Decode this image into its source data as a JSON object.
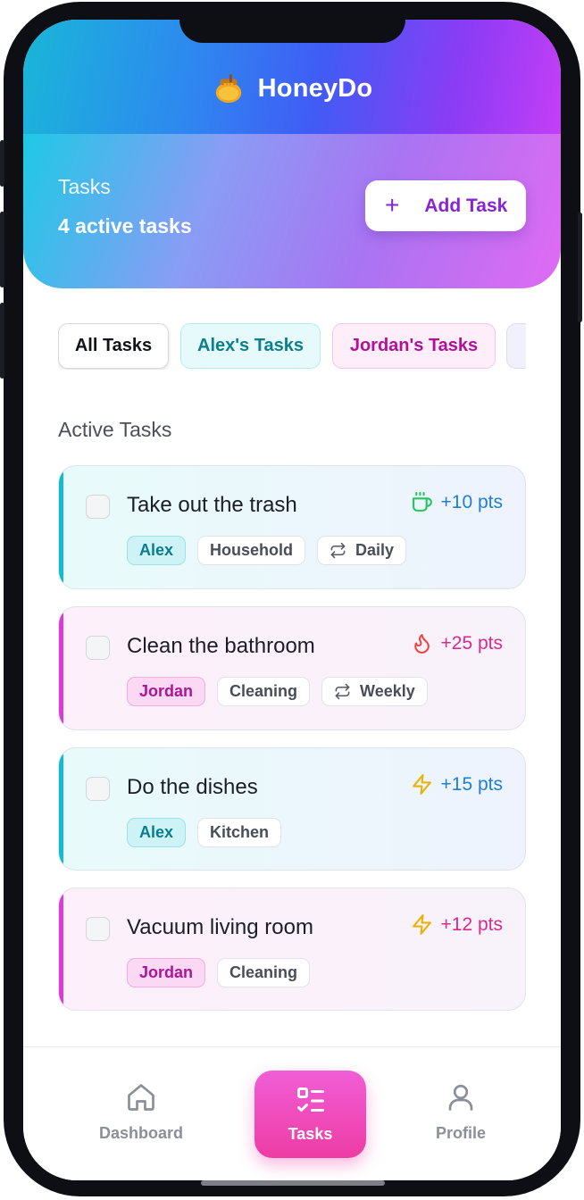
{
  "app": {
    "name": "HoneyDo",
    "logo_icon": "honey-pot-icon"
  },
  "hero": {
    "title": "Tasks",
    "subtitle": "4 active tasks",
    "add_button_label": "Add Task",
    "add_button_icon": "plus-icon"
  },
  "filters": [
    {
      "label": "All Tasks",
      "selected": true
    },
    {
      "label": "Alex's Tasks",
      "selected": false
    },
    {
      "label": "Jordan's Tasks",
      "selected": false
    },
    {
      "label": "",
      "selected": false
    }
  ],
  "section_title": "Active Tasks",
  "tasks": [
    {
      "title": "Take out the trash",
      "points": "+10 pts",
      "points_icon": "coffee-cup-icon",
      "points_color": "#1f7fd6",
      "icon_color": "#22c55e",
      "owner": "Alex",
      "category": "Household",
      "recurrence": "Daily",
      "accent": "cyan"
    },
    {
      "title": "Clean the bathroom",
      "points": "+25 pts",
      "points_icon": "flame-icon",
      "points_color": "#d92a8c",
      "icon_color": "#ef4444",
      "owner": "Jordan",
      "category": "Cleaning",
      "recurrence": "Weekly",
      "accent": "pink"
    },
    {
      "title": "Do the dishes",
      "points": "+15 pts",
      "points_icon": "lightning-icon",
      "points_color": "#1f7fd6",
      "icon_color": "#eab308",
      "owner": "Alex",
      "category": "Kitchen",
      "recurrence": "",
      "accent": "cyan"
    },
    {
      "title": "Vacuum living room",
      "points": "+12 pts",
      "points_icon": "lightning-icon",
      "points_color": "#d92a8c",
      "icon_color": "#eab308",
      "owner": "Jordan",
      "category": "Cleaning",
      "recurrence": "",
      "accent": "pink"
    }
  ],
  "nav": {
    "dashboard": {
      "label": "Dashboard",
      "icon": "home-icon"
    },
    "tasks": {
      "label": "Tasks",
      "icon": "checklist-icon",
      "active": true
    },
    "profile": {
      "label": "Profile",
      "icon": "user-icon"
    }
  },
  "colors": {
    "alex_accent": "#12bccd",
    "jordan_accent": "#d93ad8",
    "primary": "#8a22d6"
  }
}
